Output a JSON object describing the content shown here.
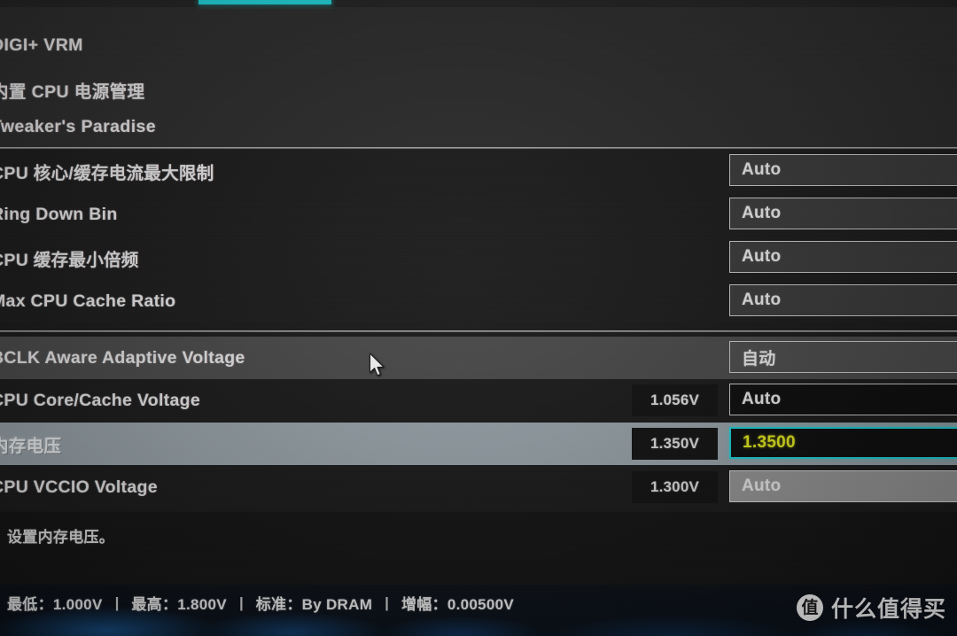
{
  "menu": {
    "items": [
      {
        "label": "DIGI+ VRM"
      },
      {
        "label": "内置 CPU 电源管理"
      },
      {
        "label": "Tweaker's Paradise"
      }
    ]
  },
  "settings": {
    "rows": [
      {
        "label": "CPU 核心/缓存电流最大限制",
        "readout": "",
        "value": "Auto",
        "state": "normal"
      },
      {
        "label": "Ring Down Bin",
        "readout": "",
        "value": "Auto",
        "state": "normal"
      },
      {
        "label": "CPU 缓存最小倍频",
        "readout": "",
        "value": "Auto",
        "state": "normal"
      },
      {
        "label": "Max CPU Cache Ratio",
        "readout": "",
        "value": "Auto",
        "state": "normal"
      },
      {
        "label": "BCLK Aware Adaptive Voltage",
        "readout": "",
        "value": "自动",
        "state": "hover"
      },
      {
        "label": "CPU Core/Cache Voltage",
        "readout": "1.056V",
        "value": "Auto",
        "state": "normal"
      },
      {
        "label": "内存电压",
        "readout": "1.350V",
        "value": "1.3500",
        "state": "selected"
      },
      {
        "label": "CPU VCCIO Voltage",
        "readout": "1.300V",
        "value": "Auto",
        "state": "normal"
      }
    ]
  },
  "description": {
    "text": "设置内存电压。"
  },
  "status": {
    "min_label": "最低：1.000V",
    "max_label": "最高：1.800V",
    "default_label": "标准：By DRAM",
    "step_label": "增幅：0.00500V",
    "divider": "|"
  },
  "watermark": {
    "logo_char": "值",
    "text": "什么值得买"
  },
  "colors": {
    "accent_cyan": "#1fd8dd",
    "active_value_yellow": "#eaf01e",
    "selected_row": "#9ba6ad"
  }
}
